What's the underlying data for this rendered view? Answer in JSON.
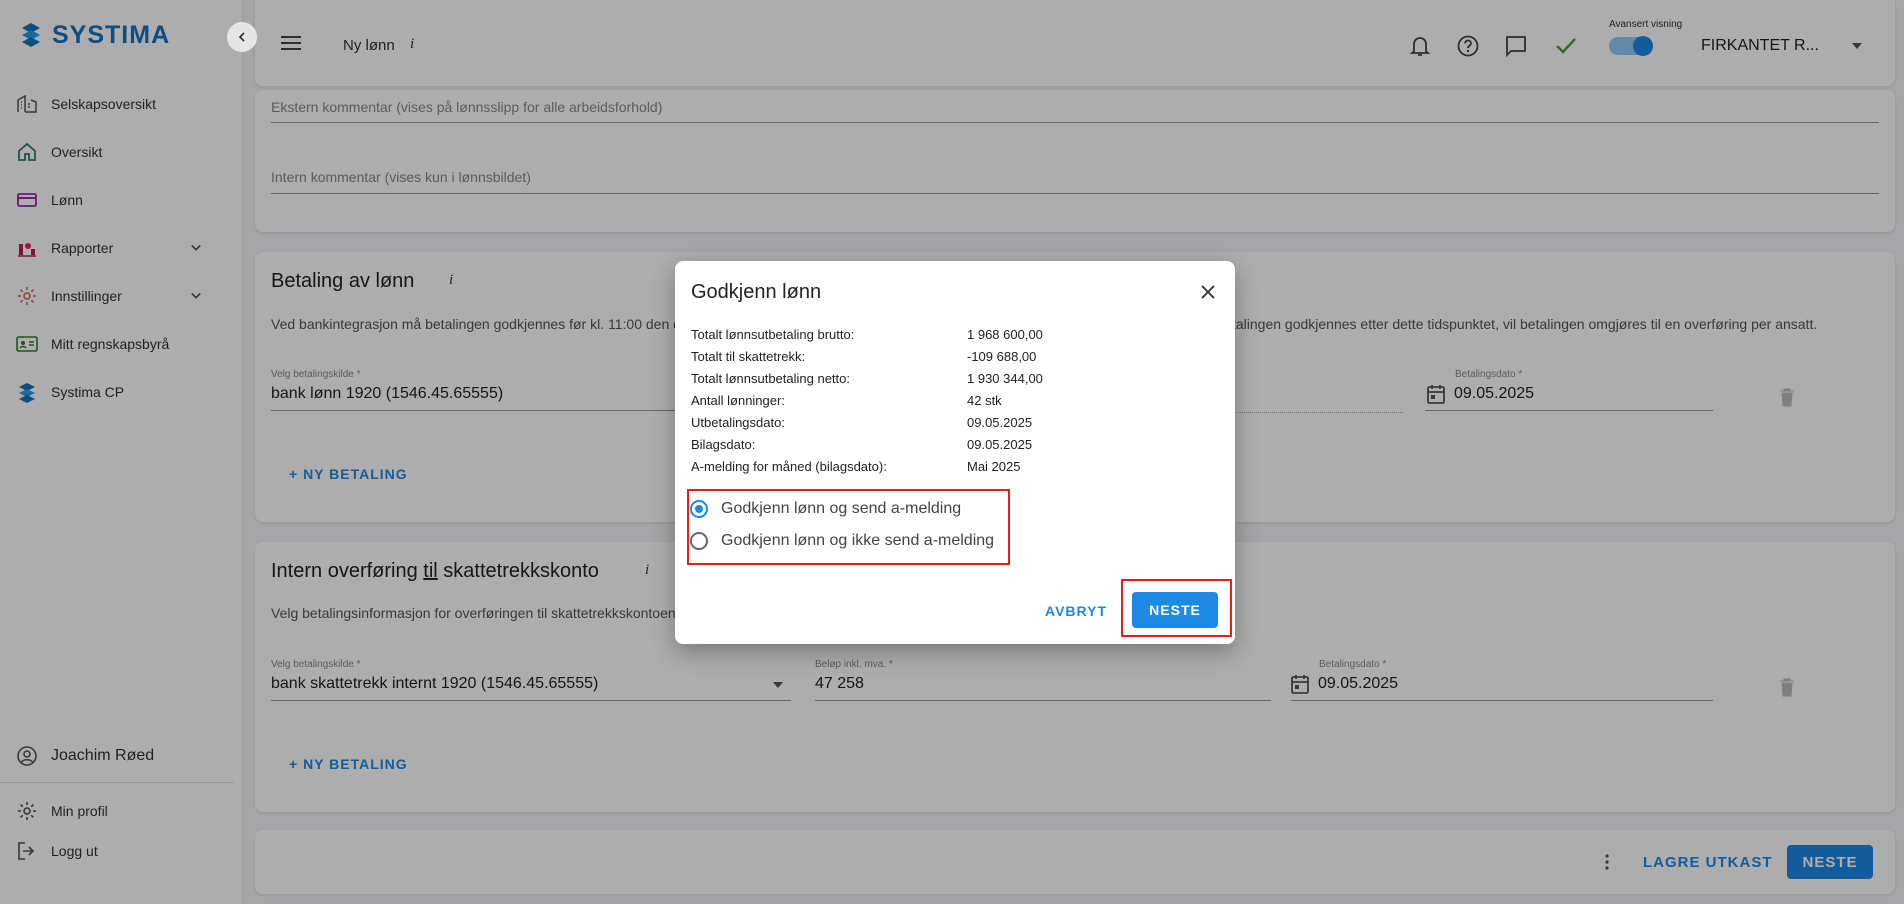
{
  "sidebar": {
    "logo": "SYSTIMA",
    "items": [
      {
        "label": "Selskapsoversikt",
        "icon": "building-icon"
      },
      {
        "label": "Oversikt",
        "icon": "home-icon"
      },
      {
        "label": "Lønn",
        "icon": "card-icon"
      },
      {
        "label": "Rapporter",
        "icon": "chart-icon"
      },
      {
        "label": "Innstillinger",
        "icon": "gear-icon"
      },
      {
        "label": "Mitt regnskapsbyrå",
        "icon": "id-card-icon"
      },
      {
        "label": "Systima CP",
        "icon": "systima-icon"
      }
    ],
    "user": "Joachim Røed",
    "profile": "Min profil",
    "logout": "Logg ut"
  },
  "topbar": {
    "title": "Ny lønn",
    "info": "i",
    "advanced_label": "Avansert visning",
    "company": "FIRKANTET R...",
    "accent": "#1e88e5"
  },
  "comments": {
    "external_placeholder": "Ekstern kommentar (vises på lønnsslipp for alle arbeidsforhold)",
    "internal_placeholder": "Intern kommentar (vises kun i lønnsbildet)"
  },
  "payment": {
    "title": "Betaling av lønn",
    "info": "i",
    "desc_left": "Ved bankintegrasjon må betalingen godkjennes før kl. 11:00 den d",
    "desc_right": "talingen godkjennes etter dette tidspunktet, vil betalingen omgjøres til en overføring per ansatt.",
    "source_label": "Velg betalingskilde *",
    "source_value": "bank lønn 1920 (1546.45.65555)",
    "date_label": "Betalingsdato *",
    "date_value": "09.05.2025",
    "new_payment": "+ NY BETALING"
  },
  "transfer": {
    "title_pre": "Intern overføring ",
    "title_til": "til",
    "title_post": " skattetrekkskonto",
    "info": "i",
    "desc": "Velg betalingsinformasjon for overføringen til skattetrekkskontoen",
    "source_label": "Velg betalingskilde *",
    "source_value": "bank skattetrekk internt 1920 (1546.45.65555)",
    "amount_label": "Beløp inkl. mva. *",
    "amount_value": "47 258",
    "date_label": "Betalingsdato *",
    "date_value": "09.05.2025",
    "new_payment": "+ NY BETALING"
  },
  "footer": {
    "save_draft": "LAGRE UTKAST",
    "next": "NESTE"
  },
  "dialog": {
    "title": "Godkjenn lønn",
    "summary": [
      {
        "key": "Totalt lønnsutbetaling brutto:",
        "value": "1 968 600,00"
      },
      {
        "key": "Totalt til skattetrekk:",
        "value": "-109 688,00"
      },
      {
        "key": "Totalt lønnsutbetaling netto:",
        "value": "1 930 344,00"
      },
      {
        "key": "Antall lønninger:",
        "value": "42 stk"
      },
      {
        "key": "Utbetalingsdato:",
        "value": "09.05.2025"
      },
      {
        "key": "Bilagsdato:",
        "value": "09.05.2025"
      },
      {
        "key": "A-melding for måned (bilagsdato):",
        "value": "Mai 2025"
      }
    ],
    "options": [
      {
        "label": "Godkjenn lønn og send a-melding",
        "selected": true
      },
      {
        "label": "Godkjenn lønn og ikke send a-melding",
        "selected": false
      }
    ],
    "cancel": "AVBRYT",
    "next": "NESTE"
  }
}
